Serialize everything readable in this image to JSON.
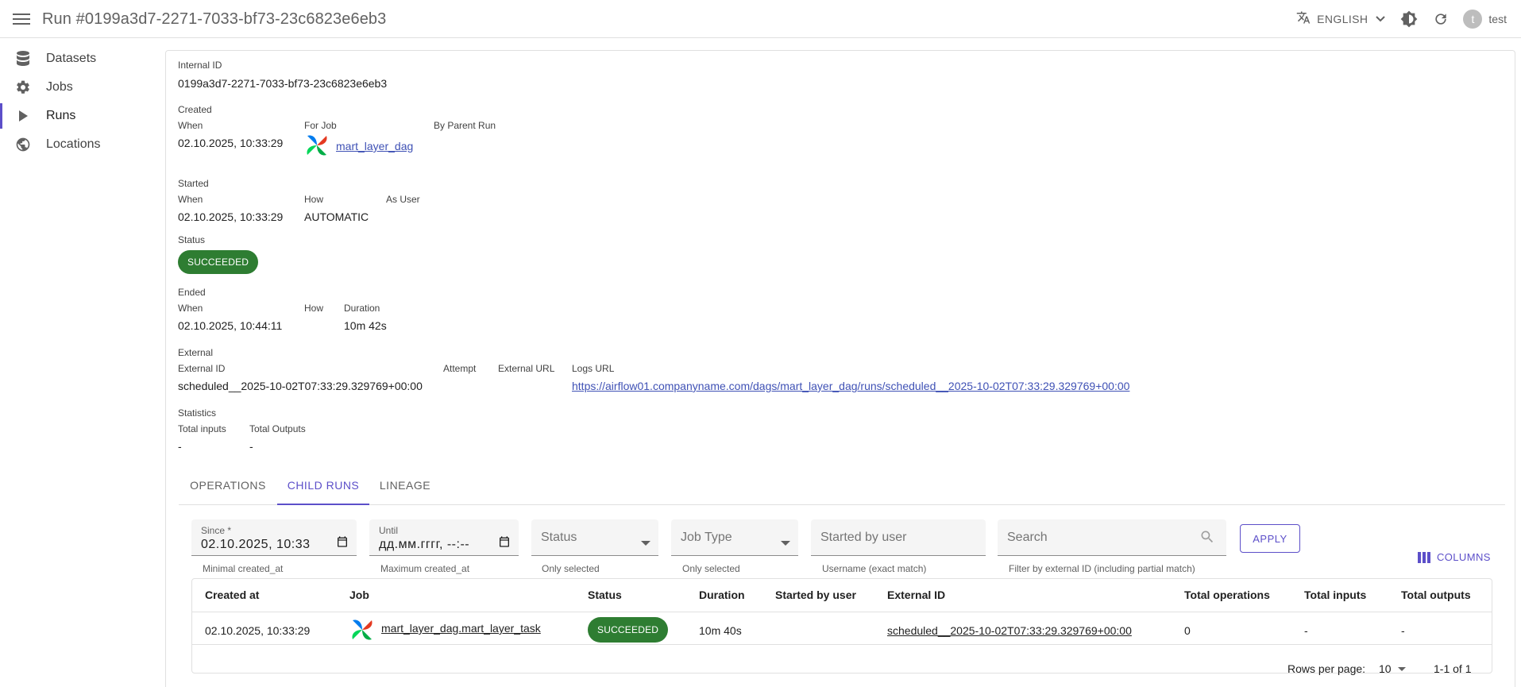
{
  "header": {
    "title": "Run #0199a3d7-2271-7033-bf73-23c6823e6eb3",
    "language": "ENGLISH",
    "user_initial": "t",
    "username": "test"
  },
  "sidebar": {
    "items": [
      {
        "label": "Datasets",
        "icon": "database-icon"
      },
      {
        "label": "Jobs",
        "icon": "gear-icon"
      },
      {
        "label": "Runs",
        "icon": "play-icon"
      },
      {
        "label": "Locations",
        "icon": "globe-icon"
      }
    ],
    "active": "Runs"
  },
  "run": {
    "internal_id_label": "Internal ID",
    "internal_id": "0199a3d7-2271-7033-bf73-23c6823e6eb3",
    "created": {
      "section": "Created",
      "when_label": "When",
      "when": "02.10.2025, 10:33:29",
      "for_job_label": "For Job",
      "for_job": "mart_layer_dag",
      "by_parent_label": "By Parent Run"
    },
    "started": {
      "section": "Started",
      "when_label": "When",
      "when": "02.10.2025, 10:33:29",
      "how_label": "How",
      "how": "AUTOMATIC",
      "as_user_label": "As User"
    },
    "status": {
      "section": "Status",
      "value": "SUCCEEDED"
    },
    "ended": {
      "section": "Ended",
      "when_label": "When",
      "when": "02.10.2025, 10:44:11",
      "how_label": "How",
      "duration_label": "Duration",
      "duration": "10m 42s"
    },
    "external": {
      "section": "External",
      "external_id_label": "External ID",
      "external_id": "scheduled__2025-10-02T07:33:29.329769+00:00",
      "attempt_label": "Attempt",
      "external_url_label": "External URL",
      "logs_url_label": "Logs URL",
      "logs_url": "https://airflow01.companyname.com/dags/mart_layer_dag/runs/scheduled__2025-10-02T07:33:29.329769+00:00"
    },
    "statistics": {
      "section": "Statistics",
      "total_inputs_label": "Total inputs",
      "total_inputs": "-",
      "total_outputs_label": "Total Outputs",
      "total_outputs": "-"
    }
  },
  "tabs": [
    "OPERATIONS",
    "CHILD RUNS",
    "LINEAGE"
  ],
  "active_tab": "CHILD RUNS",
  "filters": {
    "since_label": "Since",
    "since_value": "02.10.2025, 10:33",
    "since_helper": "Minimal created_at",
    "until_label": "Until",
    "until_value": "дд.мм.гггг, --:--",
    "until_helper": "Maximum created_at",
    "status_placeholder": "Status",
    "status_helper": "Only selected",
    "job_type_placeholder": "Job Type",
    "job_type_helper": "Only selected",
    "started_by_placeholder": "Started by user",
    "started_by_helper": "Username (exact match)",
    "search_placeholder": "Search",
    "search_helper": "Filter by external ID (including partial match)",
    "apply_label": "APPLY",
    "columns_label": "COLUMNS"
  },
  "table": {
    "columns": [
      "Created at",
      "Job",
      "Status",
      "Duration",
      "Started by user",
      "External ID",
      "Total operations",
      "Total inputs",
      "Total outputs"
    ],
    "rows": [
      {
        "created_at": "02.10.2025, 10:33:29",
        "job": "mart_layer_dag.mart_layer_task",
        "status": "SUCCEEDED",
        "duration": "10m 40s",
        "started_by": "",
        "external_id": "scheduled__2025-10-02T07:33:29.329769+00:00",
        "total_operations": "0",
        "total_inputs": "-",
        "total_outputs": "-"
      }
    ]
  },
  "pagination": {
    "rows_per_page_label": "Rows per page:",
    "rows_per_page": "10",
    "range": "1-1 of 1"
  },
  "colors": {
    "accent": "#5c4fc9",
    "success": "#2e7d32",
    "link": "#3f51b5"
  }
}
